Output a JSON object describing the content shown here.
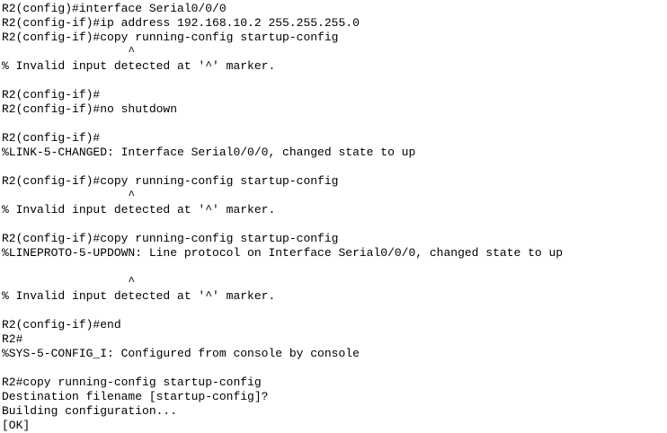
{
  "terminal": {
    "lines": [
      "R2(config)#interface Serial0/0/0",
      "R2(config-if)#ip address 192.168.10.2 255.255.255.0",
      "R2(config-if)#copy running-config startup-config",
      "                  ^",
      "% Invalid input detected at '^' marker.",
      "",
      "R2(config-if)#",
      "R2(config-if)#no shutdown",
      "",
      "R2(config-if)#",
      "%LINK-5-CHANGED: Interface Serial0/0/0, changed state to up",
      "",
      "R2(config-if)#copy running-config startup-config",
      "                  ^",
      "% Invalid input detected at '^' marker.",
      "",
      "R2(config-if)#copy running-config startup-config",
      "%LINEPROTO-5-UPDOWN: Line protocol on Interface Serial0/0/0, changed state to up",
      "",
      "                  ^",
      "% Invalid input detected at '^' marker.",
      "",
      "R2(config-if)#end",
      "R2#",
      "%SYS-5-CONFIG_I: Configured from console by console",
      "",
      "R2#copy running-config startup-config",
      "Destination filename [startup-config]?",
      "Building configuration...",
      "[OK]"
    ]
  }
}
